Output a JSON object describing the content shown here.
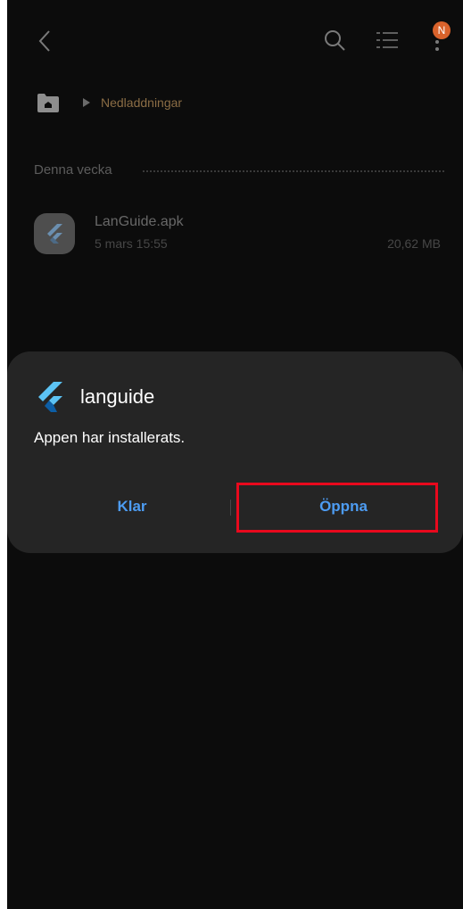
{
  "topbar": {
    "back_icon": "back-chevron-icon",
    "search_icon": "search-icon",
    "list_icon": "list-view-icon",
    "more_icon": "more-vertical-icon",
    "badge_text": "N",
    "badge_color": "#d9622b"
  },
  "breadcrumb": {
    "home_icon": "home-folder-icon",
    "separator_icon": "triangle-right-icon",
    "current": "Nedladdningar",
    "current_color": "#8b6d45"
  },
  "section": {
    "title": "Denna vecka"
  },
  "file": {
    "icon": "flutter-app-icon",
    "name": "LanGuide.apk",
    "date": "5 mars 15:55",
    "size": "20,62 MB"
  },
  "dialog": {
    "app_icon": "flutter-logo-icon",
    "app_name": "languide",
    "message": "Appen har installerats.",
    "done_label": "Klar",
    "open_label": "Öppna",
    "button_color": "#4d9cf2",
    "highlight_color": "#e8091d"
  }
}
